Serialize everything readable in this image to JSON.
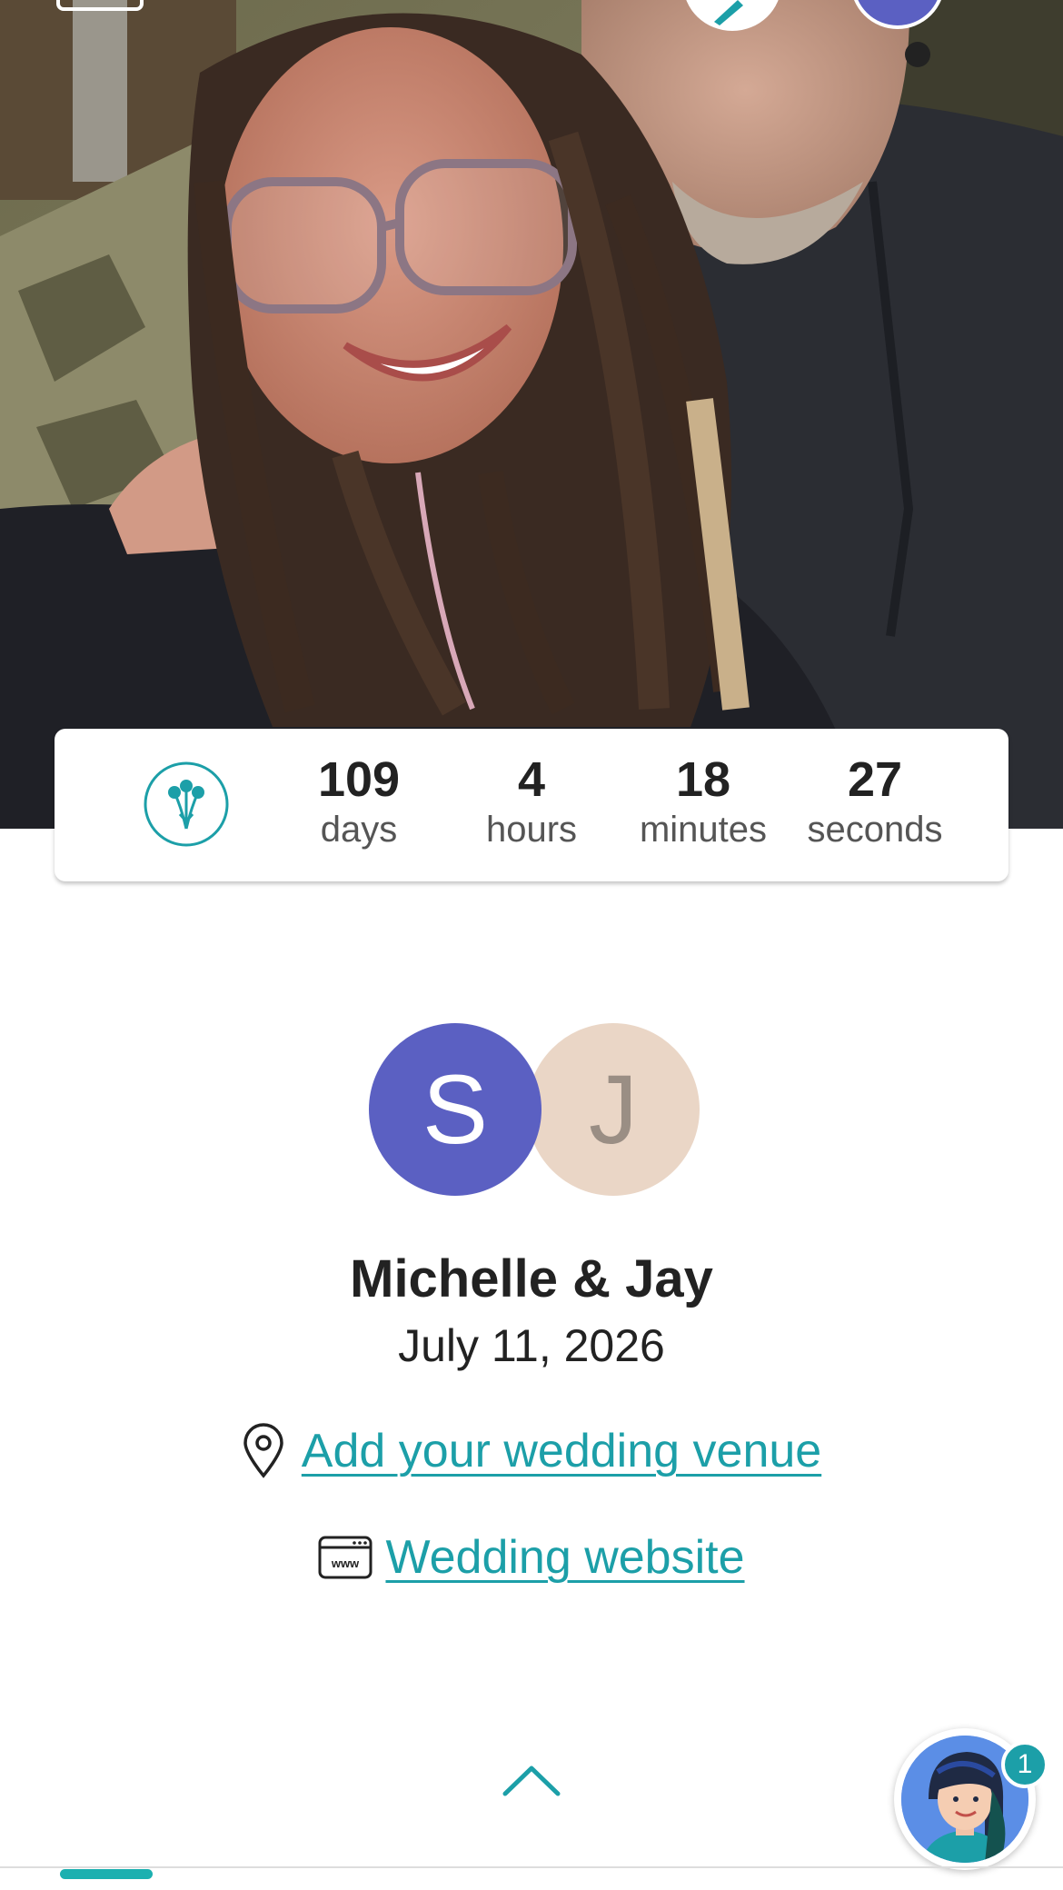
{
  "hero": {
    "photo": "couple-selfie-photo"
  },
  "countdown": {
    "icon": "bouquet-icon",
    "days": {
      "value": "109",
      "label": "days"
    },
    "hours": {
      "value": "4",
      "label": "hours"
    },
    "minutes": {
      "value": "18",
      "label": "minutes"
    },
    "seconds": {
      "value": "27",
      "label": "seconds"
    }
  },
  "couple": {
    "avatar1_initial": "S",
    "avatar2_initial": "J",
    "names": "Michelle & Jay",
    "date": "July 11, 2026"
  },
  "links": {
    "venue_icon": "location-pin-icon",
    "venue_label": "Add your wedding venue",
    "website_icon": "www-browser-icon",
    "website_label": "Wedding website"
  },
  "footer": {
    "scroll_up_icon": "chevron-up-icon",
    "assistant_icon": "assistant-avatar-icon",
    "assistant_badge": "1"
  },
  "colors": {
    "accent": "#1c9fa8",
    "avatar_s": "#5b60c2",
    "avatar_j": "#ead6c6"
  }
}
